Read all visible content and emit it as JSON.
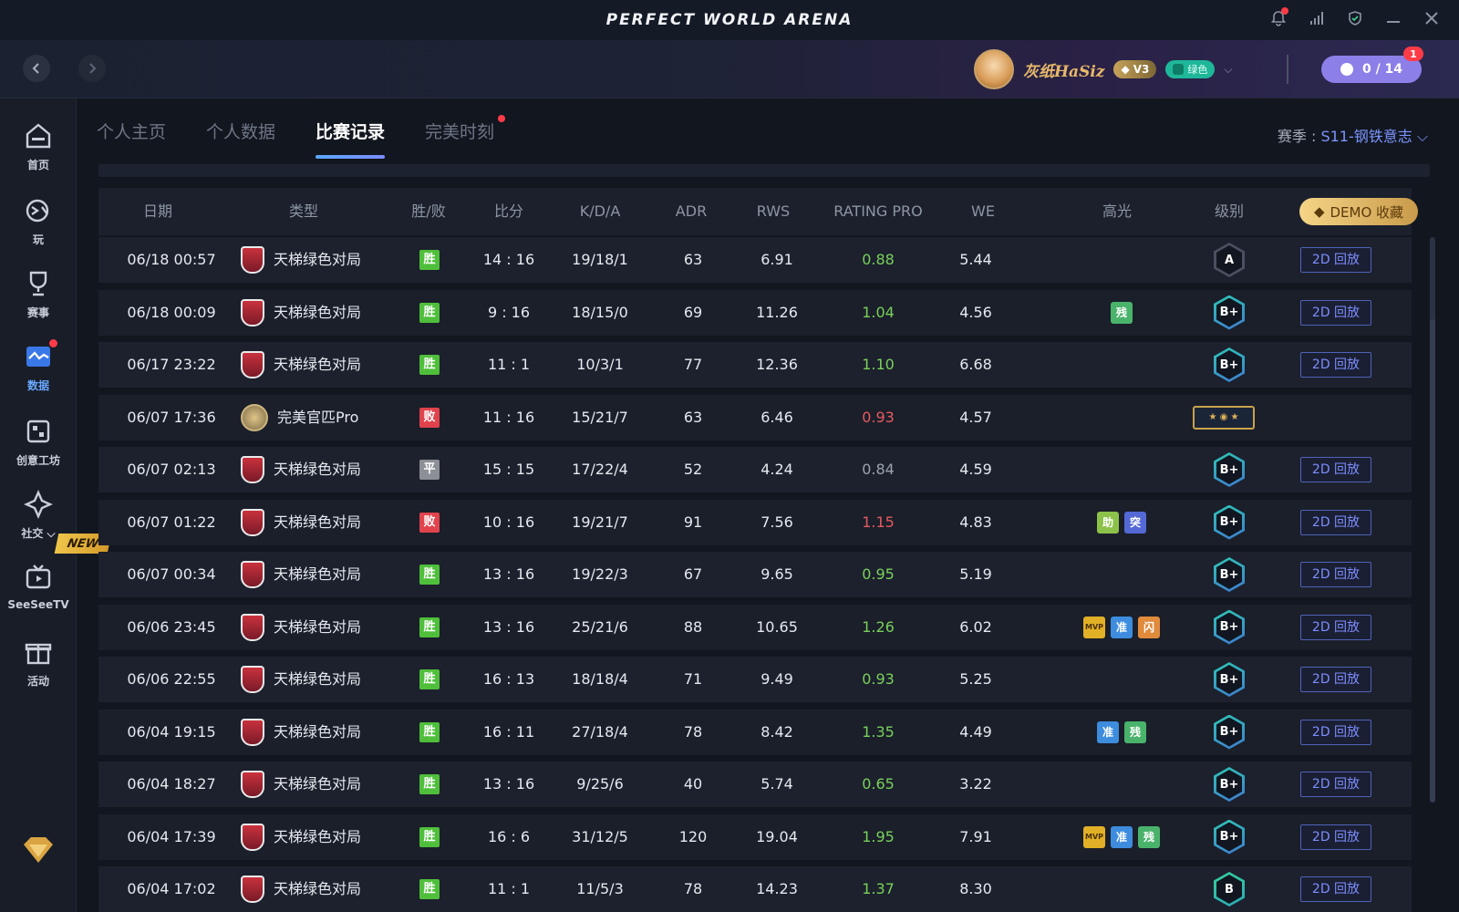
{
  "app": {
    "title": "PERFECT WORLD ARENA"
  },
  "header": {
    "username": "灰纸HaSiz",
    "vip": "V3",
    "trust": "绿色",
    "party": "0 / 14",
    "party_badge": "1"
  },
  "sidebar": {
    "items": [
      {
        "label": "首页",
        "icon": "home-icon"
      },
      {
        "label": "玩",
        "icon": "gamepad-icon"
      },
      {
        "label": "赛事",
        "icon": "trophy-icon"
      },
      {
        "label": "数据",
        "icon": "chart-icon"
      },
      {
        "label": "创意工坊",
        "icon": "workshop-icon"
      },
      {
        "label": "社交 ⌵",
        "icon": "social-icon"
      },
      {
        "label": "SeeSeeTV",
        "icon": "tv-icon"
      },
      {
        "label": "活动",
        "icon": "gift-icon"
      }
    ],
    "new_tag": "NEW"
  },
  "tabs": [
    "个人主页",
    "个人数据",
    "比赛记录",
    "完美时刻"
  ],
  "season": {
    "label": "赛季 : ",
    "value": "S11-钢铁意志"
  },
  "table": {
    "headers": {
      "date": "日期",
      "type": "类型",
      "result": "胜/败",
      "score": "比分",
      "kda": "K/D/A",
      "adr": "ADR",
      "rws": "RWS",
      "rating": "RATING PRO",
      "we": "WE",
      "highlight": "高光",
      "rank": "级别"
    },
    "demo_label": "DEMO 收藏",
    "replay_label": "2D 回放",
    "rows": [
      {
        "date": "06/18 00:57",
        "type": "天梯绿色对局",
        "result": "胜",
        "score": "14 : 16",
        "kda": "19/18/1",
        "adr": "63",
        "rws": "6.91",
        "rating": "0.88",
        "we": "5.44",
        "highlights": [],
        "rank": "A"
      },
      {
        "date": "06/18 00:09",
        "type": "天梯绿色对局",
        "result": "胜",
        "score": "9 : 16",
        "kda": "18/15/0",
        "adr": "69",
        "rws": "11.26",
        "rating": "1.04",
        "we": "4.56",
        "highlights": [
          "残"
        ],
        "rank": "B+"
      },
      {
        "date": "06/17 23:22",
        "type": "天梯绿色对局",
        "result": "胜",
        "score": "11 : 1",
        "kda": "10/3/1",
        "adr": "77",
        "rws": "12.36",
        "rating": "1.10",
        "we": "6.68",
        "highlights": [],
        "rank": "B+"
      },
      {
        "date": "06/07 17:36",
        "type": "完美官匹Pro",
        "result": "败",
        "score": "11 : 16",
        "kda": "15/21/7",
        "adr": "63",
        "rws": "6.46",
        "rating": "0.93",
        "we": "4.57",
        "highlights": [],
        "rank": ""
      },
      {
        "date": "06/07 02:13",
        "type": "天梯绿色对局",
        "result": "平",
        "score": "15 : 15",
        "kda": "17/22/4",
        "adr": "52",
        "rws": "4.24",
        "rating": "0.84",
        "we": "4.59",
        "highlights": [],
        "rank": "B+"
      },
      {
        "date": "06/07 01:22",
        "type": "天梯绿色对局",
        "result": "败",
        "score": "10 : 16",
        "kda": "19/21/7",
        "adr": "91",
        "rws": "7.56",
        "rating": "1.15",
        "we": "4.83",
        "highlights": [
          "助",
          "突"
        ],
        "rank": "B+"
      },
      {
        "date": "06/07 00:34",
        "type": "天梯绿色对局",
        "result": "胜",
        "score": "13 : 16",
        "kda": "19/22/3",
        "adr": "67",
        "rws": "9.65",
        "rating": "0.95",
        "we": "5.19",
        "highlights": [],
        "rank": "B+"
      },
      {
        "date": "06/06 23:45",
        "type": "天梯绿色对局",
        "result": "胜",
        "score": "13 : 16",
        "kda": "25/21/6",
        "adr": "88",
        "rws": "10.65",
        "rating": "1.26",
        "we": "6.02",
        "highlights": [
          "MVP",
          "准",
          "闪"
        ],
        "rank": "B+"
      },
      {
        "date": "06/06 22:55",
        "type": "天梯绿色对局",
        "result": "胜",
        "score": "16 : 13",
        "kda": "18/18/4",
        "adr": "71",
        "rws": "9.49",
        "rating": "0.93",
        "we": "5.25",
        "highlights": [],
        "rank": "B+"
      },
      {
        "date": "06/04 19:15",
        "type": "天梯绿色对局",
        "result": "胜",
        "score": "16 : 11",
        "kda": "27/18/4",
        "adr": "78",
        "rws": "8.42",
        "rating": "1.35",
        "we": "4.49",
        "highlights": [
          "准",
          "残"
        ],
        "rank": "B+"
      },
      {
        "date": "06/04 18:27",
        "type": "天梯绿色对局",
        "result": "胜",
        "score": "13 : 16",
        "kda": "9/25/6",
        "adr": "40",
        "rws": "5.74",
        "rating": "0.65",
        "we": "3.22",
        "highlights": [],
        "rank": "B+"
      },
      {
        "date": "06/04 17:39",
        "type": "天梯绿色对局",
        "result": "胜",
        "score": "16 : 6",
        "kda": "31/12/5",
        "adr": "120",
        "rws": "19.04",
        "rating": "1.95",
        "we": "7.91",
        "highlights": [
          "MVP",
          "准",
          "残"
        ],
        "rank": "B+"
      },
      {
        "date": "06/04 17:02",
        "type": "天梯绿色对局",
        "result": "胜",
        "score": "11 : 1",
        "kda": "11/5/3",
        "adr": "78",
        "rws": "14.23",
        "rating": "1.37",
        "we": "8.30",
        "highlights": [],
        "rank": "B"
      }
    ]
  }
}
